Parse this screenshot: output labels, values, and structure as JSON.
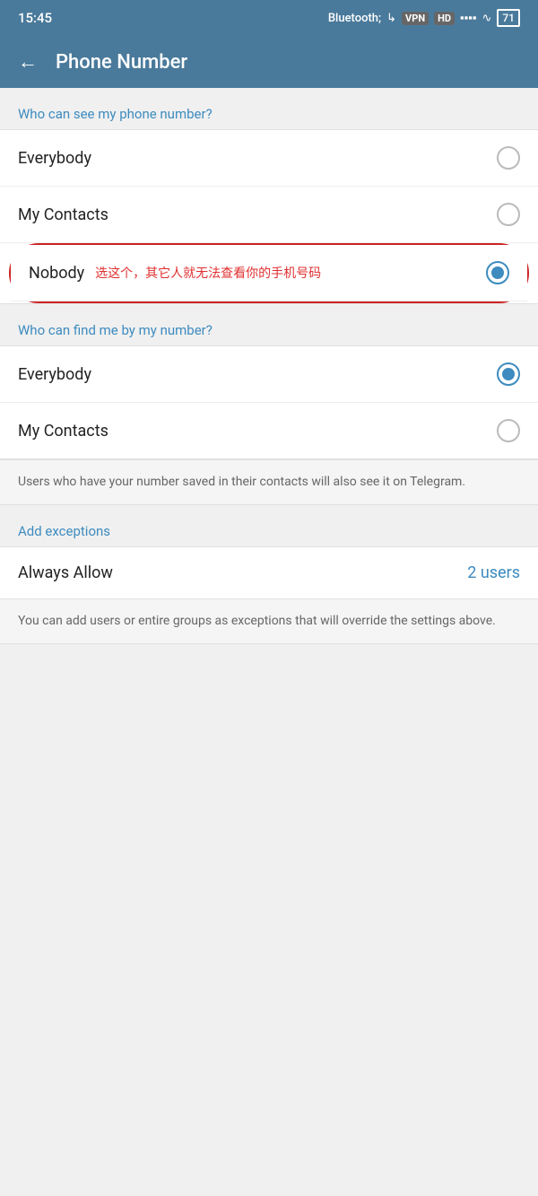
{
  "statusBar": {
    "time": "15:45",
    "icons": [
      "bluetooth",
      "vpn",
      "hd",
      "signal",
      "wifi",
      "battery"
    ]
  },
  "header": {
    "backLabel": "←",
    "title": "Phone Number"
  },
  "section1": {
    "label": "Who can see my phone number?",
    "options": [
      {
        "id": "everybody1",
        "label": "Everybody",
        "selected": false
      },
      {
        "id": "mycontacts1",
        "label": "My Contacts",
        "selected": false
      },
      {
        "id": "nobody",
        "label": "Nobody",
        "annotation": "选这个，其它人就无法查看你的手机号码",
        "selected": true
      }
    ]
  },
  "section2": {
    "label": "Who can find me by my number?",
    "options": [
      {
        "id": "everybody2",
        "label": "Everybody",
        "selected": true
      },
      {
        "id": "mycontacts2",
        "label": "My Contacts",
        "selected": false
      }
    ]
  },
  "section2Info": "Users who have your number saved in their contacts will also see it on Telegram.",
  "exceptions": {
    "label": "Add exceptions",
    "alwaysAllow": {
      "label": "Always Allow",
      "count": "2 users"
    },
    "info": "You can add users or entire groups as exceptions that will override the settings above."
  }
}
